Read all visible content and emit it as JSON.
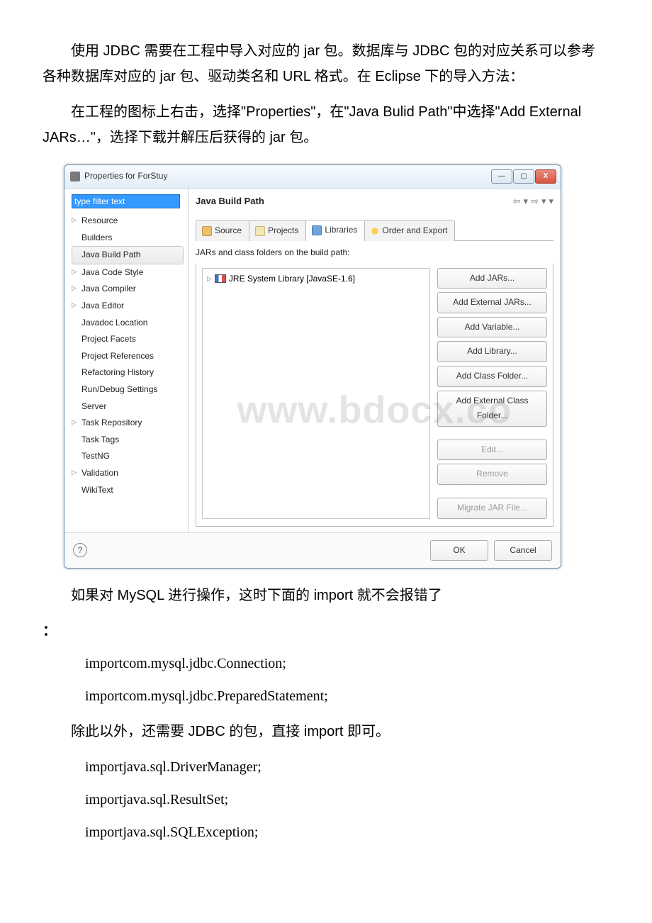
{
  "para1": "使用 JDBC 需要在工程中导入对应的 jar 包。数据库与 JDBC 包的对应关系可以参考各种数据库对应的 jar 包、驱动类名和 URL 格式。在 Eclipse 下的导入方法：",
  "para2": "在工程的图标上右击，选择\"Properties\"，在\"Java Bulid Path\"中选择\"Add External JARs…\"，选择下载并解压后获得的 jar 包。",
  "para3": "如果对 MySQL 进行操作，这时下面的 import 就不会报错了",
  "colon": "：",
  "code1": "importcom.mysql.jdbc.Connection;",
  "code2": "importcom.mysql.jdbc.PreparedStatement;",
  "para4": "除此以外，还需要 JDBC 的包，直接 import 即可。",
  "code3": "importjava.sql.DriverManager;",
  "code4": "importjava.sql.ResultSet;",
  "code5": "importjava.sql.SQLException;",
  "watermark": "www.bdocx.co",
  "dialog": {
    "title": "Properties for ForStuy",
    "filter_value": "type filter text",
    "tree": [
      {
        "label": "Resource",
        "expandable": true
      },
      {
        "label": "Builders"
      },
      {
        "label": "Java Build Path",
        "selected": true
      },
      {
        "label": "Java Code Style",
        "expandable": true
      },
      {
        "label": "Java Compiler",
        "expandable": true
      },
      {
        "label": "Java Editor",
        "expandable": true
      },
      {
        "label": "Javadoc Location"
      },
      {
        "label": "Project Facets"
      },
      {
        "label": "Project References"
      },
      {
        "label": "Refactoring History"
      },
      {
        "label": "Run/Debug Settings"
      },
      {
        "label": "Server"
      },
      {
        "label": "Task Repository",
        "expandable": true
      },
      {
        "label": "Task Tags"
      },
      {
        "label": "TestNG"
      },
      {
        "label": "Validation",
        "expandable": true
      },
      {
        "label": "WikiText"
      }
    ],
    "main_title": "Java Build Path",
    "tabs": {
      "source": "Source",
      "projects": "Projects",
      "libraries": "Libraries",
      "order": "Order and Export"
    },
    "lib_desc": "JARs and class folders on the build path:",
    "lib_item": "JRE System Library [JavaSE-1.6]",
    "buttons": {
      "add_jars": "Add JARs...",
      "add_ext_jars": "Add External JARs...",
      "add_var": "Add Variable...",
      "add_lib": "Add Library...",
      "add_class_folder": "Add Class Folder...",
      "add_ext_class_folder": "Add External Class Folder...",
      "edit": "Edit...",
      "remove": "Remove",
      "migrate": "Migrate JAR File..."
    },
    "footer": {
      "ok": "OK",
      "cancel": "Cancel"
    },
    "winbtn": {
      "min": "—",
      "max": "▢",
      "close": "X"
    }
  }
}
